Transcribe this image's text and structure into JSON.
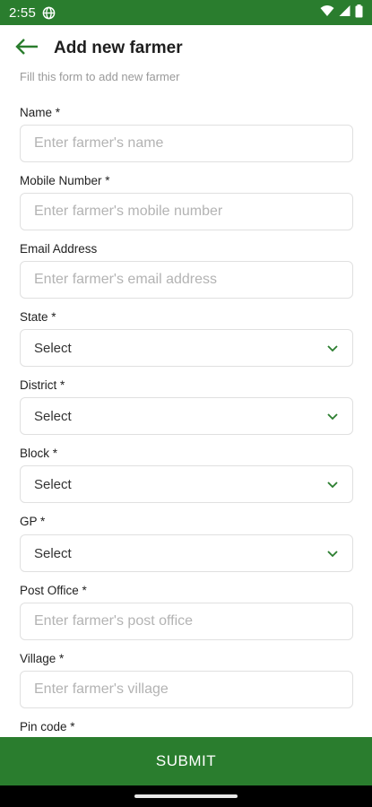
{
  "status_bar": {
    "time": "2:55"
  },
  "header": {
    "title": "Add new farmer"
  },
  "subtitle": "Fill this form to add new farmer",
  "fields": [
    {
      "label": "Name *",
      "placeholder": "Enter farmer's name",
      "value": ""
    },
    {
      "label": "Mobile Number *",
      "placeholder": "Enter farmer's mobile number",
      "value": ""
    },
    {
      "label": "Email Address",
      "placeholder": "Enter farmer's email address",
      "value": ""
    },
    {
      "label": "State *",
      "selected": "Select"
    },
    {
      "label": "District *",
      "selected": "Select"
    },
    {
      "label": "Block *",
      "selected": "Select"
    },
    {
      "label": "GP *",
      "selected": "Select"
    },
    {
      "label": "Post Office *",
      "placeholder": "Enter farmer's post office",
      "value": ""
    },
    {
      "label": "Village *",
      "placeholder": "Enter farmer's village",
      "value": ""
    },
    {
      "label": "Pin code *"
    }
  ],
  "submit_label": "SUBMIT",
  "colors": {
    "brand_green": "#2a7d2e",
    "border": "#e0e0e0",
    "placeholder": "#b3b3b3"
  },
  "icons": [
    "globe-icon",
    "wifi-icon",
    "signal-icon",
    "battery-icon",
    "back-arrow-icon",
    "chevron-down-icon"
  ]
}
